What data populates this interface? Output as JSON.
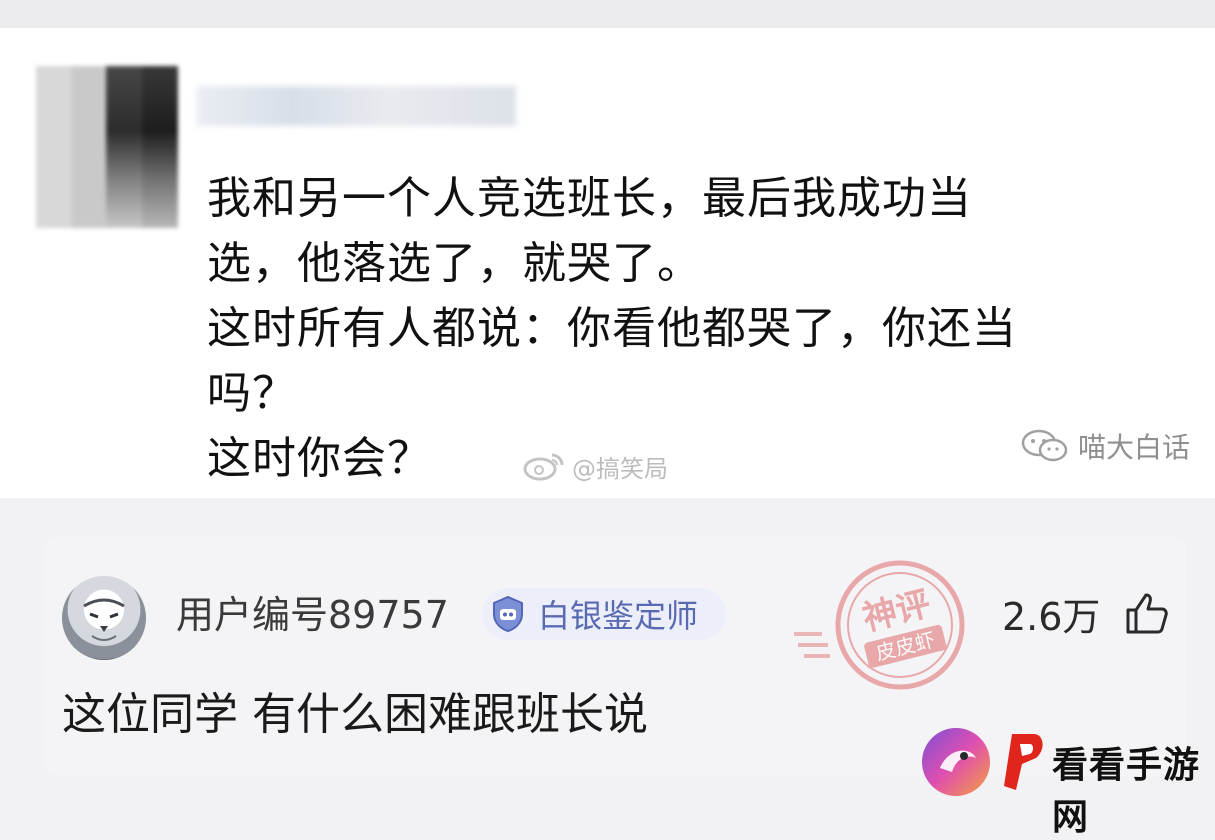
{
  "post": {
    "lines": [
      "我和另一个人竞选班长，最后我成功当",
      "选，他落选了，就哭了。",
      "这时所有人都说：你看他都哭了，你还当",
      "吗？",
      "这时你会？"
    ],
    "weibo_watermark": "@搞笑局",
    "wechat_watermark": "喵大白话"
  },
  "comment": {
    "username": "用户编号89757",
    "badge": "白银鉴定师",
    "stamp_top": "神评",
    "stamp_bottom": "皮皮虾",
    "likes": "2.6万",
    "text": "这位同学 有什么困难跟班长说"
  },
  "site": {
    "name": "看看手游网"
  },
  "colors": {
    "badge_text": "#5a6ab0",
    "stamp_red": "#e06a6a",
    "logo_red": "#e0261c"
  }
}
